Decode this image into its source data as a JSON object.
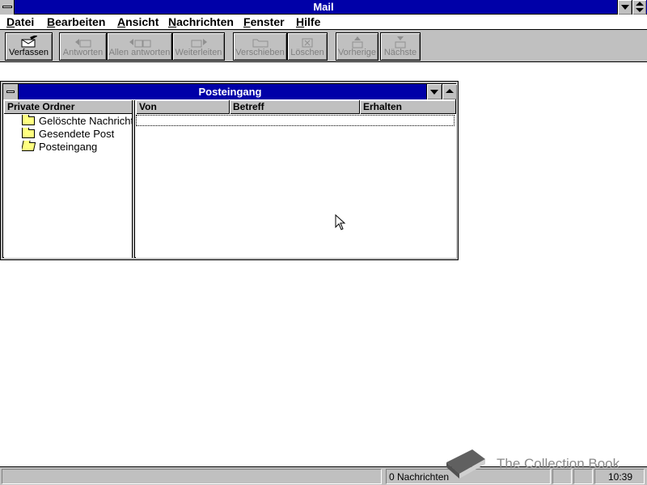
{
  "app": {
    "title": "Mail"
  },
  "menu": [
    {
      "label": "Datei"
    },
    {
      "label": "Bearbeiten"
    },
    {
      "label": "Ansicht"
    },
    {
      "label": "Nachrichten"
    },
    {
      "label": "Fenster"
    },
    {
      "label": "Hilfe"
    }
  ],
  "toolbar": {
    "compose": "Verfassen",
    "reply": "Antworten",
    "reply_all": "Allen antworten",
    "forward": "Weiterleiten",
    "move": "Verschieben",
    "delete": "Löschen",
    "previous": "Vorherige",
    "next": "Nächste"
  },
  "inbox_window": {
    "title": "Posteingang",
    "folder_header": "Private Ordner",
    "folders": [
      {
        "label": "Gelöschte Nachrichten",
        "icon": "folder-icon"
      },
      {
        "label": "Gesendete Post",
        "icon": "folder-icon"
      },
      {
        "label": "Posteingang",
        "icon": "open-folder-icon"
      }
    ],
    "columns": [
      "Von",
      "Betreff",
      "Erhalten"
    ]
  },
  "statusbar": {
    "message_count": "0 Nachrichten",
    "time": "10:39"
  },
  "watermark": {
    "text": "The Collection Book"
  },
  "colors": {
    "titlebar": "#0000a8",
    "chrome": "#c0c0c0",
    "folder": "#ffff80"
  }
}
